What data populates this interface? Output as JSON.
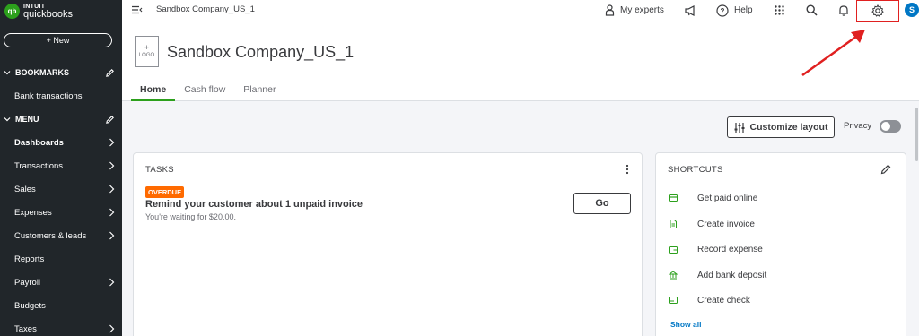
{
  "brand": {
    "line1": "INTUIT",
    "line2": "quickbooks",
    "mark": "qb",
    "color": "#2ca01c"
  },
  "sidebar": {
    "new_label": "+ New",
    "bookmarks_label": "BOOKMARKS",
    "bookmark_items": [
      {
        "label": "Bank transactions"
      }
    ],
    "menu_label": "MENU",
    "items": [
      {
        "label": "Dashboards",
        "bold": true,
        "arrow": true
      },
      {
        "label": "Transactions",
        "arrow": true
      },
      {
        "label": "Sales",
        "arrow": true
      },
      {
        "label": "Expenses",
        "arrow": true
      },
      {
        "label": "Customers & leads",
        "arrow": true
      },
      {
        "label": "Reports",
        "arrow": false
      },
      {
        "label": "Payroll",
        "arrow": true
      },
      {
        "label": "Budgets",
        "arrow": false
      },
      {
        "label": "Taxes",
        "arrow": true
      }
    ]
  },
  "topbar": {
    "company": "Sandbox Company_US_1",
    "my_experts": "My experts",
    "help": "Help",
    "avatar_initial": "S",
    "icons": [
      "hamburger-icon",
      "experts-icon",
      "megaphone-icon",
      "help-icon",
      "apps-grid-icon",
      "search-icon",
      "bell-icon",
      "gear-icon"
    ]
  },
  "header": {
    "logo_placeholder": {
      "plus": "+",
      "text": "LOGO"
    },
    "company_title": "Sandbox Company_US_1",
    "tabs": [
      {
        "label": "Home",
        "active": true
      },
      {
        "label": "Cash flow",
        "active": false
      },
      {
        "label": "Planner",
        "active": false
      }
    ]
  },
  "main": {
    "customize_label": "Customize layout",
    "privacy_label": "Privacy",
    "privacy_on": false
  },
  "tasks": {
    "title": "TASKS",
    "badge": "OVERDUE",
    "task_title": "Remind your customer about 1 unpaid invoice",
    "task_sub": "You're waiting for $20.00.",
    "go_label": "Go"
  },
  "shortcuts": {
    "title": "SHORTCUTS",
    "items": [
      {
        "label": "Get paid online",
        "icon": "card-icon"
      },
      {
        "label": "Create invoice",
        "icon": "invoice-icon"
      },
      {
        "label": "Record expense",
        "icon": "expense-icon"
      },
      {
        "label": "Add bank deposit",
        "icon": "deposit-icon"
      },
      {
        "label": "Create check",
        "icon": "check-icon"
      }
    ],
    "show_all": "Show all"
  },
  "colors": {
    "sidebar_bg": "#21262a",
    "accent": "#2ca01c",
    "link": "#0077c5",
    "overdue": "#ff6a00",
    "highlight": "#e02020"
  }
}
